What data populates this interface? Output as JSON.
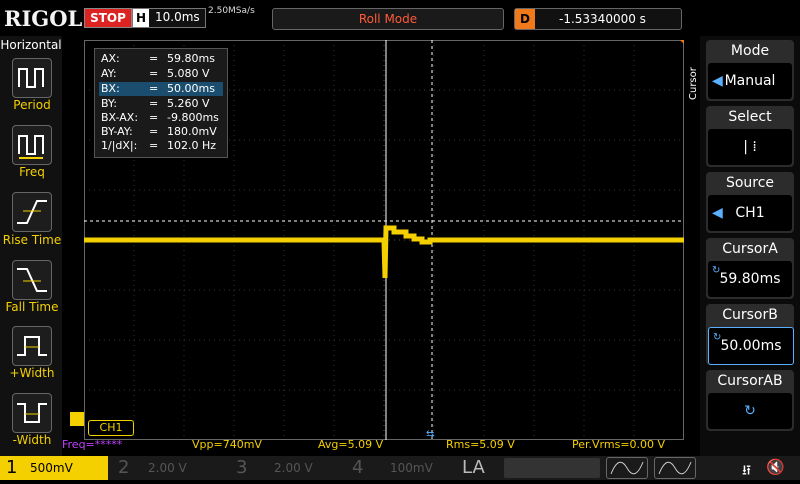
{
  "header": {
    "brand": "RIGOL",
    "run_state": "STOP",
    "timebase_label": "H",
    "timebase_value": "10.0ms",
    "sample_rate": "2.50MSa/s",
    "acq_mode": "Roll Mode",
    "delay_label": "D",
    "delay_value": "-1.53340000 s"
  },
  "left_panel": {
    "title": "Horizontal",
    "items": [
      {
        "label": "Period"
      },
      {
        "label": "Freq"
      },
      {
        "label": "Rise Time"
      },
      {
        "label": "Fall Time"
      },
      {
        "label": "+Width"
      },
      {
        "label": "-Width"
      }
    ]
  },
  "readout": {
    "rows": [
      {
        "key": "AX:",
        "eq": "=",
        "value": "59.80ms"
      },
      {
        "key": "AY:",
        "eq": "=",
        "value": "5.080 V"
      },
      {
        "key": "BX:",
        "eq": "=",
        "value": "50.00ms"
      },
      {
        "key": "BY:",
        "eq": "=",
        "value": "5.260 V"
      },
      {
        "key": "BX-AX:",
        "eq": "=",
        "value": "-9.800ms"
      },
      {
        "key": "BY-AY:",
        "eq": "=",
        "value": "180.0mV"
      },
      {
        "key": "1/|dX|:",
        "eq": "=",
        "value": "102.0 Hz"
      }
    ]
  },
  "right_menu": {
    "side_label": "Cursor",
    "items": [
      {
        "title": "Mode",
        "value": "Manual"
      },
      {
        "title": "Select",
        "value": "|  ⁞"
      },
      {
        "title": "Source",
        "value": "CH1"
      },
      {
        "title": "CursorA",
        "value": "59.80ms"
      },
      {
        "title": "CursorB",
        "value": "50.00ms"
      },
      {
        "title": "CursorAB",
        "value": ""
      }
    ]
  },
  "channel_tag": "CH1",
  "measurements": {
    "freq": "Freq=*****",
    "vpp": "Vpp=740mV",
    "avg": "Avg=5.09 V",
    "rms": "Rms=5.09 V",
    "pervrms": "Per.Vrms=0.00 V"
  },
  "bottom": {
    "ch1_num": "1",
    "ch1_scale": "500mV",
    "ch2_num": "2",
    "ch2_scale": "2.00 V",
    "ch3_num": "3",
    "ch3_scale": "2.00 V",
    "ch4_num": "4",
    "ch4_scale": "100mV",
    "la": "LA"
  },
  "colors": {
    "ch1": "#f4d000",
    "cursor": "#ffffff",
    "stop": "#dd2222",
    "delay": "#f07a1a",
    "mode_text": "#ff5a3a"
  }
}
